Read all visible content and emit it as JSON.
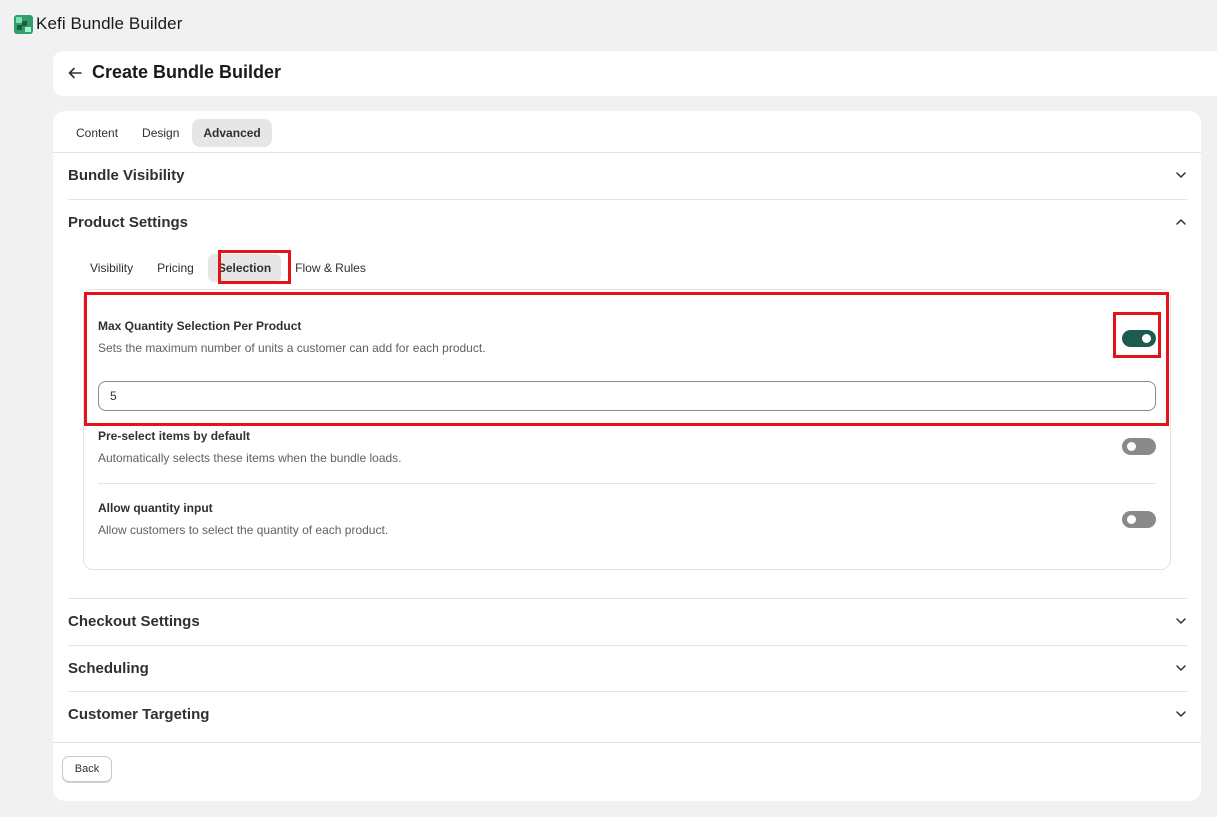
{
  "app": {
    "title": "Kefi Bundle Builder",
    "logo_icon": "kefi-logo",
    "brand_color": "#2f9e6b"
  },
  "header": {
    "back_icon": "arrow-left-icon",
    "title": "Create Bundle Builder"
  },
  "main_tabs": [
    {
      "label": "Content",
      "active": false
    },
    {
      "label": "Design",
      "active": false
    },
    {
      "label": "Advanced",
      "active": true
    }
  ],
  "sections": {
    "bundle_visibility": {
      "title": "Bundle Visibility",
      "expanded": false
    },
    "product_settings": {
      "title": "Product Settings",
      "expanded": true
    },
    "checkout_settings": {
      "title": "Checkout Settings",
      "expanded": false
    },
    "scheduling": {
      "title": "Scheduling",
      "expanded": false
    },
    "customer_targeting": {
      "title": "Customer Targeting",
      "expanded": false
    }
  },
  "product_tabs": [
    {
      "label": "Visibility",
      "active": false
    },
    {
      "label": "Pricing",
      "active": false
    },
    {
      "label": "Selection",
      "active": true
    },
    {
      "label": "Flow & Rules",
      "active": false
    }
  ],
  "selection_settings": {
    "max_quantity": {
      "title": "Max Quantity Selection Per Product",
      "description": "Sets the maximum number of units a customer can add for each product.",
      "enabled": true,
      "value": "5"
    },
    "preselect": {
      "title": "Pre-select items by default",
      "description": "Automatically selects these items when the bundle loads.",
      "enabled": false
    },
    "quantity_input": {
      "title": "Allow quantity input",
      "description": "Allow customers to select the quantity of each product.",
      "enabled": false
    }
  },
  "footer": {
    "back_label": "Back"
  },
  "colors": {
    "toggle_on": "#1d5b4f",
    "toggle_off": "#8a8a8a",
    "highlight": "#e3131c",
    "page_bg": "#f1f1f1"
  }
}
